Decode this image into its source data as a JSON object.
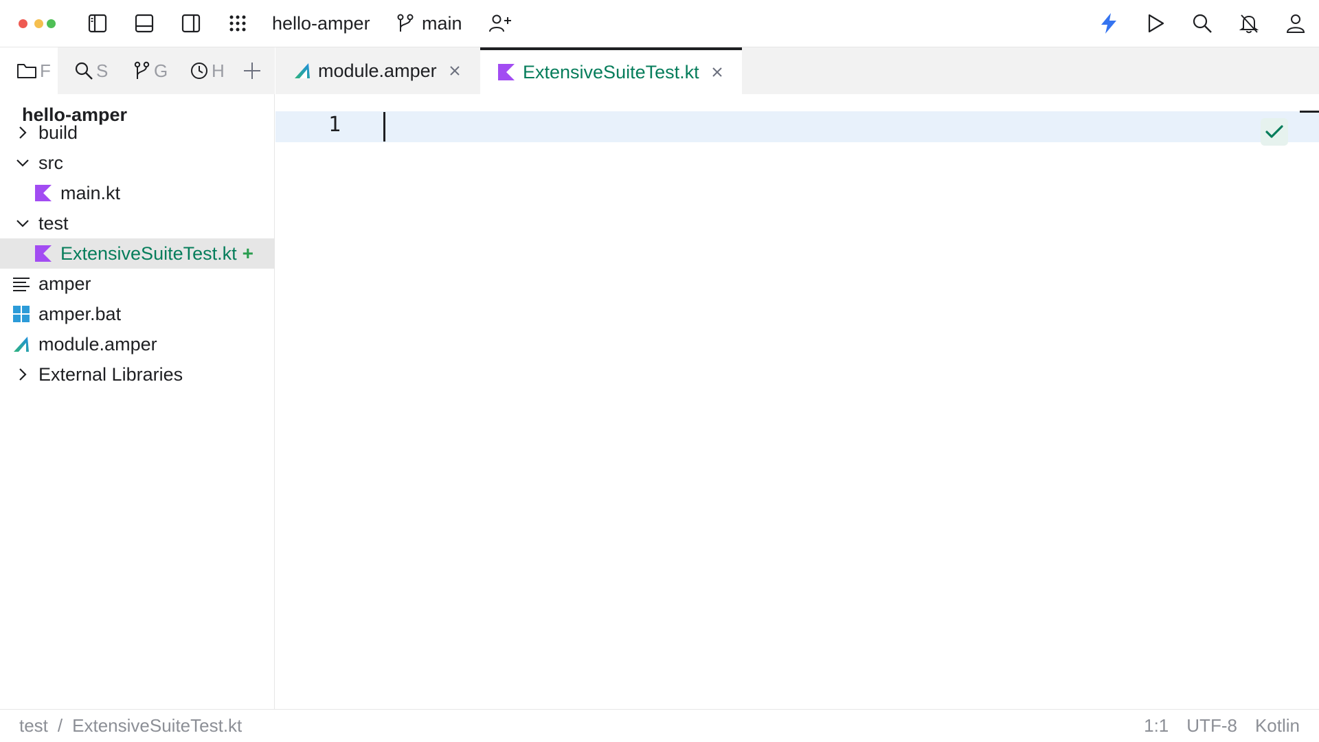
{
  "window": {
    "project_name": "hello-amper",
    "branch": "main"
  },
  "tool_window_tabs": [
    {
      "letter": "F",
      "icon": "folder-icon"
    },
    {
      "letter": "S",
      "icon": "search-icon"
    },
    {
      "letter": "G",
      "icon": "git-branch-icon"
    },
    {
      "letter": "H",
      "icon": "clock-icon"
    }
  ],
  "editor_tabs": [
    {
      "label": "module.amper",
      "icon": "amper-icon",
      "active": false
    },
    {
      "label": "ExtensiveSuiteTest.kt",
      "icon": "kotlin-icon",
      "active": true
    }
  ],
  "project_tree": {
    "title": "hello-amper",
    "items": [
      {
        "label": "build",
        "type": "folder",
        "expanded": false
      },
      {
        "label": "src",
        "type": "folder",
        "expanded": true
      },
      {
        "label": "main.kt",
        "type": "kotlin-file"
      },
      {
        "label": "test",
        "type": "folder",
        "expanded": true
      },
      {
        "label": "ExtensiveSuiteTest.kt",
        "type": "kotlin-file",
        "status": "added",
        "selected": true
      },
      {
        "label": "amper",
        "type": "text-file"
      },
      {
        "label": "amper.bat",
        "type": "windows-file"
      },
      {
        "label": "module.amper",
        "type": "amper-file"
      },
      {
        "label": "External Libraries",
        "type": "libraries",
        "expanded": false
      }
    ]
  },
  "editor": {
    "line_numbers": [
      "1"
    ]
  },
  "statusbar": {
    "breadcrumb": [
      "test",
      "ExtensiveSuiteTest.kt"
    ],
    "separator": "/",
    "position": "1:1",
    "encoding": "UTF-8",
    "language": "Kotlin"
  },
  "colors": {
    "accent_green": "#067d5b",
    "added_plus": "#2a9d4f",
    "kotlin_purple": "#a24cf2",
    "lightning_blue": "#3574f0",
    "caret_line": "#e8f1fb"
  }
}
